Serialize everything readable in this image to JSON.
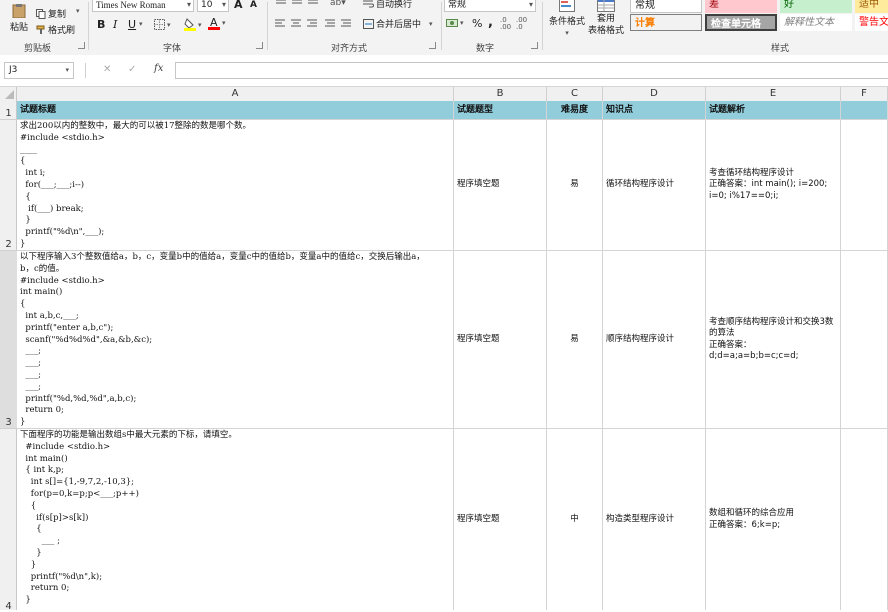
{
  "ribbon": {
    "clipboard": {
      "paste": "粘贴",
      "copy": "复制",
      "format_painter": "格式刷",
      "group": "剪贴板"
    },
    "font": {
      "font_name": "Times New Roman",
      "font_size": "10",
      "bold": "B",
      "italic": "I",
      "underline": "U",
      "grow": "A",
      "shrink": "A",
      "group": "字体"
    },
    "alignment": {
      "wrap_text": "自动换行",
      "merge_center": "合并后居中",
      "group": "对齐方式"
    },
    "number": {
      "format": "常规",
      "percent": "%",
      "comma": ",",
      "group": "数字"
    },
    "styles": {
      "cond_format": "条件格式",
      "table_format_1": "套用",
      "table_format_2": "表格格式",
      "group": "样式",
      "cells": [
        {
          "label": "常规",
          "bg": "#ffffff",
          "fg": "#222222"
        },
        {
          "label": "差",
          "bg": "#ffc7ce",
          "fg": "#9c0006"
        },
        {
          "label": "好",
          "bg": "#c6efce",
          "fg": "#006100"
        },
        {
          "label": "适中",
          "bg": "#ffeb9c",
          "fg": "#9c5700"
        },
        {
          "label": "计算",
          "bg": "#f2f2f2",
          "fg": "#fa7d00"
        },
        {
          "label": "检查单元格",
          "bg": "#a5a5a5",
          "fg": "#ffffff"
        },
        {
          "label": "解释性文本",
          "bg": "#ffffff",
          "fg": "#7f7f7f"
        },
        {
          "label": "警告文本",
          "bg": "#ffffff",
          "fg": "#ff0000"
        }
      ]
    }
  },
  "formula_bar": {
    "name_box": "J3",
    "cancel": "✕",
    "enter": "✓",
    "fx": "fx",
    "value": ""
  },
  "columns": [
    "A",
    "B",
    "C",
    "D",
    "E",
    "F"
  ],
  "header_row": {
    "row_num": "1",
    "a": "试题标题",
    "b": "试题题型",
    "c": "难易度",
    "d": "知识点",
    "e": "试题解析",
    "f": ""
  },
  "rows": [
    {
      "row_num": "2",
      "a": "求出200以内的整数中，最大的可以被17整除的数是哪个数。\n#include <stdio.h>\n____\n{\n  int i;\n  for(___;___;i--)\n  {\n   if(___) break;\n  }\n  printf(\"%d\\n\",___);\n}",
      "b": "程序填空题",
      "c": "易",
      "d": "循环结构程序设计",
      "e": "考查循环结构程序设计\n正确答案：int main(); i=200; i=0; i%17==0;i;"
    },
    {
      "row_num": "3",
      "a": "以下程序输入3个整数值给a，b，c，变量b中的值给a，变量c中的值给b，变量a中的值给c，交换后输出a，\nb，c的值。\n#include <stdio.h>\nint main()\n{\n  int a,b,c,___;\n  printf(\"enter a,b,c\");\n  scanf(\"%d%d%d\",&a,&b,&c);\n  ___;\n  ___;\n  ___;\n  ___;\n  printf(\"%d,%d,%d\",a,b,c);\n  return 0;\n}",
      "b": "程序填空题",
      "c": "易",
      "d": "顺序结构程序设计",
      "e": "考查顺序结构程序设计和交换3数的算法\n正确答案：d;d=a;a=b;b=c;c=d;"
    },
    {
      "row_num": "4",
      "a": "下面程序的功能是输出数组s中最大元素的下标，请填空。\n  #include <stdio.h>\n  int main()\n  { int k,p;\n    int s[]={1,-9,7,2,-10,3};\n    for(p=0,k=p;p<___;p++)\n    {\n      if(s[p]>s[k])\n      {\n        ___ ;\n      }\n    }\n    printf(\"%d\\n\",k);\n    return 0;\n  }",
      "b": "程序填空题",
      "c": "中",
      "d": "构造类型程序设计",
      "e": "数组和循环的综合应用\n正确答案：6;k=p;"
    }
  ]
}
